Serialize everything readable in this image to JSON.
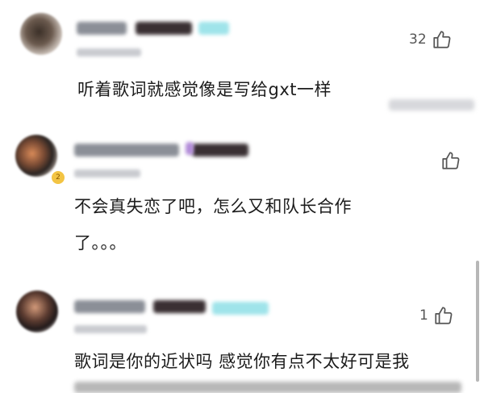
{
  "comments": [
    {
      "text": "听着歌词就感觉像是写给gxt一样",
      "likes": "32",
      "avatar_icon": "avatar"
    },
    {
      "text_line1": "不会真失恋了吧，怎么又和队长合作",
      "text_line2": "了。。。",
      "likes": "",
      "avatar_icon": "avatar"
    },
    {
      "text_line1": "歌词是你的近状吗 感觉你有点不太好可是我",
      "likes": "1",
      "avatar_icon": "avatar"
    }
  ],
  "colors": {
    "text": "#1c1c1c",
    "like_icon": "#555555",
    "vip_badge": "#f3c443"
  }
}
